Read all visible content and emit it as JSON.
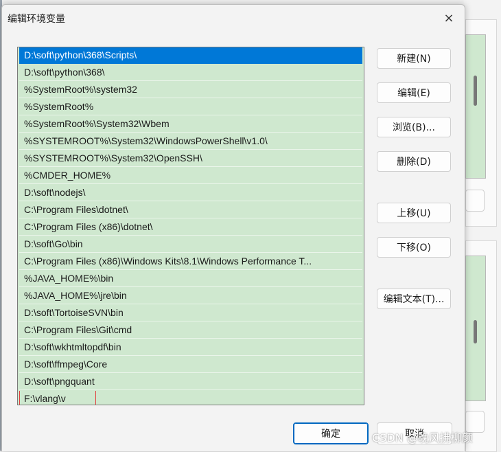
{
  "dialog": {
    "title": "编辑环境变量",
    "close_icon": "×"
  },
  "path_list": {
    "items": [
      "D:\\soft\\python\\368\\Scripts\\",
      "D:\\soft\\python\\368\\",
      "%SystemRoot%\\system32",
      "%SystemRoot%",
      "%SystemRoot%\\System32\\Wbem",
      "%SYSTEMROOT%\\System32\\WindowsPowerShell\\v1.0\\",
      "%SYSTEMROOT%\\System32\\OpenSSH\\",
      "%CMDER_HOME%",
      "D:\\soft\\nodejs\\",
      "C:\\Program Files\\dotnet\\",
      "C:\\Program Files (x86)\\dotnet\\",
      "D:\\soft\\Go\\bin",
      "C:\\Program Files (x86)\\Windows Kits\\8.1\\Windows Performance T...",
      "%JAVA_HOME%\\bin",
      "%JAVA_HOME%\\jre\\bin",
      "D:\\soft\\TortoiseSVN\\bin",
      "C:\\Program Files\\Git\\cmd",
      "D:\\soft\\wkhtmltopdf\\bin",
      "D:\\soft\\ffmpeg\\Core",
      "D:\\soft\\pngquant",
      "F:\\vlang\\v"
    ],
    "selected_index": 0,
    "editing_index": 20
  },
  "buttons": {
    "new": "新建(N)",
    "edit": "编辑(E)",
    "browse": "浏览(B)...",
    "delete": "删除(D)",
    "move_up": "上移(U)",
    "move_down": "下移(O)",
    "edit_text": "编辑文本(T)...",
    "ok": "确定",
    "cancel": "取消"
  },
  "watermark": "CSDN @晚风拂柳颜",
  "colors": {
    "list_bg": "#cfe8cf",
    "selection": "#0078d7",
    "edit_outline": "#e23b3b",
    "primary_border": "#0067c0"
  }
}
